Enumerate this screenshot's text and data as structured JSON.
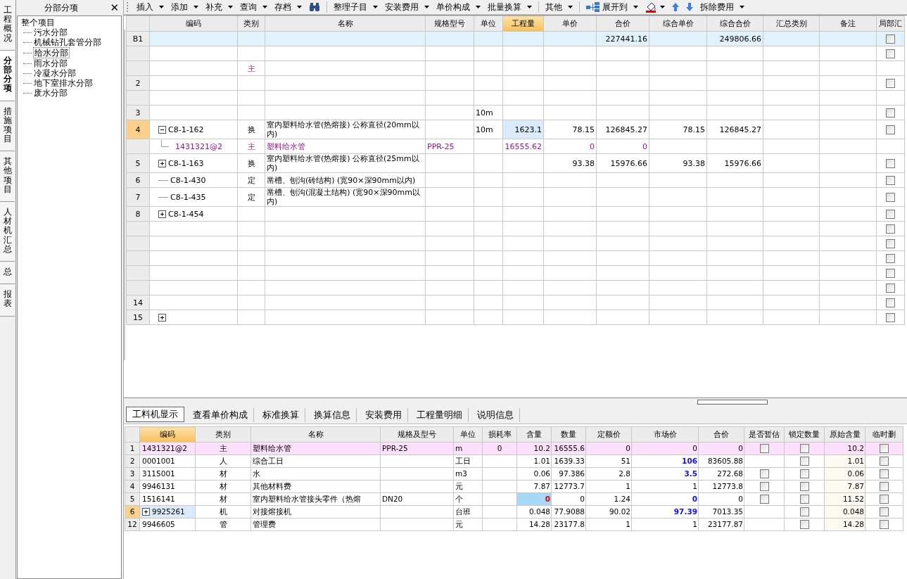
{
  "side_tabs": [
    {
      "label": "工程概况",
      "selected": false
    },
    {
      "label": "分部分项",
      "selected": true
    },
    {
      "label": "措施项目",
      "selected": false
    },
    {
      "label": "其他项目",
      "selected": false
    },
    {
      "label": "人材机汇总",
      "selected": false
    },
    {
      "label": "总",
      "selected": false
    },
    {
      "label": "报表",
      "selected": false
    }
  ],
  "tree_panel": {
    "title": "分部分项",
    "close": "✕",
    "root": {
      "label": "整个项目",
      "selected": false,
      "children": [
        {
          "label": "污水分部",
          "selected": false
        },
        {
          "label": "机械钻孔套管分部",
          "selected": false
        },
        {
          "label": "给水分部",
          "selected": true
        },
        {
          "label": "雨水分部",
          "selected": false
        },
        {
          "label": "冷凝水分部",
          "selected": false
        },
        {
          "label": "地下室排水分部",
          "selected": false
        },
        {
          "label": "废水分部",
          "selected": false
        }
      ]
    }
  },
  "toolbar": [
    {
      "kind": "menu",
      "label": "插入"
    },
    {
      "kind": "menu",
      "label": "添加"
    },
    {
      "kind": "menu",
      "label": "补充"
    },
    {
      "kind": "menu",
      "label": "查询"
    },
    {
      "kind": "menu",
      "label": "存档"
    },
    {
      "kind": "binoculars"
    },
    {
      "kind": "separator"
    },
    {
      "kind": "menu",
      "label": "整理子目"
    },
    {
      "kind": "menu",
      "label": "安装费用"
    },
    {
      "kind": "menu",
      "label": "单价构成"
    },
    {
      "kind": "menu",
      "label": "批量换算"
    },
    {
      "kind": "separator"
    },
    {
      "kind": "menu",
      "label": "其他"
    },
    {
      "kind": "separator"
    },
    {
      "kind": "expand",
      "label": "展开到"
    },
    {
      "kind": "paint"
    },
    {
      "kind": "up"
    },
    {
      "kind": "down"
    },
    {
      "kind": "menu",
      "label": "拆除费用"
    }
  ],
  "upper_table": {
    "columns": [
      {
        "label": "编码",
        "selected": false
      },
      {
        "label": "类别",
        "selected": false
      },
      {
        "label": "名称",
        "selected": false
      },
      {
        "label": "规格型号",
        "selected": false
      },
      {
        "label": "单位",
        "selected": false
      },
      {
        "label": "工程量",
        "selected": true
      },
      {
        "label": "单价",
        "selected": false
      },
      {
        "label": "合价",
        "selected": false
      },
      {
        "label": "综合单价",
        "selected": false
      },
      {
        "label": "综合合价",
        "selected": false
      },
      {
        "label": "汇总类别",
        "selected": false
      },
      {
        "label": "备注",
        "selected": false
      },
      {
        "label": "局部汇",
        "selected": false
      }
    ],
    "rows": [
      {
        "kind": "section",
        "no": "B1",
        "total": "227441.16",
        "grand_total": "249806.66",
        "partial_checked": false,
        "selected": false
      },
      {
        "kind": "item",
        "partial_checked": false,
        "selected": false
      },
      {
        "kind": "material",
        "type": "主",
        "selected": false
      },
      {
        "kind": "item",
        "no": "2",
        "partial_checked": false,
        "selected": false
      },
      {
        "kind": "material",
        "selected": false
      },
      {
        "kind": "item",
        "no": "3",
        "unit": "10m",
        "partial_checked": false,
        "selected": false
      },
      {
        "kind": "item",
        "no": "4",
        "code": "C8-1-162",
        "expanded": true,
        "type": "换",
        "name": "室内塑料给水管(热熔接) 公称直径(20mm以内)",
        "unit": "10m",
        "qty": "1623.1",
        "price": "78.15",
        "total": "126845.27",
        "unit_price": "78.15",
        "grand_total": "126845.27",
        "partial_checked": false,
        "selected": true
      },
      {
        "kind": "material",
        "code": "1431321@2",
        "type": "主",
        "name": "塑料给水管",
        "spec": "PPR-25",
        "qty": "16555.62",
        "price": "0",
        "total": "0",
        "selected": false
      },
      {
        "kind": "item",
        "no": "5",
        "code": "C8-1-163",
        "expanded": false,
        "type": "换",
        "name": "室内塑料给水管(热熔接) 公称直径(25mm以内)",
        "price": "93.38",
        "total": "15976.66",
        "unit_price": "93.38",
        "grand_total": "15976.66",
        "partial_checked": false,
        "selected": false
      },
      {
        "kind": "item",
        "no": "6",
        "code": "C8-1-430",
        "type": "定",
        "name": "凿槽、刨沟(砖结构) (宽90×深90mm以内)",
        "partial_checked": false,
        "selected": false
      },
      {
        "kind": "item",
        "no": "7",
        "code": "C8-1-435",
        "type": "定",
        "name": "凿槽、刨沟(混凝土结构) (宽90×深90mm以内)",
        "partial_checked": false,
        "selected": false
      },
      {
        "kind": "item",
        "no": "8",
        "code": "C8-1-454",
        "expanded": false,
        "partial_checked": false,
        "selected": false
      },
      {
        "kind": "item",
        "partial_checked": false,
        "selected": false
      },
      {
        "kind": "item",
        "partial_checked": false,
        "selected": false
      },
      {
        "kind": "item",
        "partial_checked": false,
        "selected": false
      },
      {
        "kind": "item",
        "partial_checked": false,
        "selected": false
      },
      {
        "kind": "item",
        "partial_checked": false,
        "selected": false
      },
      {
        "kind": "item",
        "no": "14",
        "partial_checked": false,
        "selected": false
      },
      {
        "kind": "item",
        "no": "15",
        "expanded": false,
        "partial_checked": false,
        "selected": false
      }
    ]
  },
  "bottom_tabs": [
    {
      "label": "工料机显示",
      "selected": true
    },
    {
      "label": "查看单价构成",
      "selected": false
    },
    {
      "label": "标准换算",
      "selected": false
    },
    {
      "label": "换算信息",
      "selected": false
    },
    {
      "label": "安装费用",
      "selected": false
    },
    {
      "label": "工程量明细",
      "selected": false
    },
    {
      "label": "说明信息",
      "selected": false
    }
  ],
  "bottom_table": {
    "columns": [
      {
        "label": "编码",
        "selected": true
      },
      {
        "label": "类别",
        "selected": false
      },
      {
        "label": "名称",
        "selected": false
      },
      {
        "label": "规格及型号",
        "selected": false
      },
      {
        "label": "单位",
        "selected": false
      },
      {
        "label": "损耗率",
        "selected": false
      },
      {
        "label": "含量",
        "selected": false
      },
      {
        "label": "数量",
        "selected": false
      },
      {
        "label": "定额价",
        "selected": false
      },
      {
        "label": "市场价",
        "selected": false
      },
      {
        "label": "合价",
        "selected": false
      },
      {
        "label": "是否暂估",
        "selected": false
      },
      {
        "label": "锁定数量",
        "selected": false
      },
      {
        "label": "原始含量",
        "selected": false
      },
      {
        "label": "临时删",
        "selected": false
      }
    ],
    "rows": [
      {
        "kind": "main",
        "no": "1",
        "code": "1431321@2",
        "type": "主",
        "name": "塑料给水管",
        "spec": "PPR-25",
        "unit": "m",
        "loss": "0",
        "content": "10.2",
        "content_error": false,
        "qty": "16555.6",
        "quota_price": "0",
        "market_price": "0",
        "market_changed": false,
        "total": "0",
        "estimate_checked": false,
        "lock_checked": false,
        "original": "10.2",
        "delete_checked": false,
        "selected": false
      },
      {
        "kind": "normal",
        "no": "2",
        "code": "0001001",
        "type": "人",
        "name": "综合工日",
        "unit": "工日",
        "content": "1.01",
        "content_error": false,
        "qty": "1639.33",
        "quota_price": "51",
        "market_price": "106",
        "market_changed": true,
        "total": "83605.88",
        "lock_checked": false,
        "original": "1.01",
        "delete_checked": false,
        "selected": false
      },
      {
        "kind": "normal",
        "no": "3",
        "code": "3115001",
        "type": "材",
        "name": "水",
        "unit": "m3",
        "content": "0.06",
        "content_error": false,
        "qty": "97.386",
        "quota_price": "2.8",
        "market_price": "3.5",
        "market_changed": true,
        "total": "272.68",
        "estimate_checked": false,
        "lock_checked": false,
        "original": "0.06",
        "delete_checked": false,
        "selected": false
      },
      {
        "kind": "normal",
        "no": "4",
        "code": "9946131",
        "type": "材",
        "name": "其他材料费",
        "unit": "元",
        "content": "7.87",
        "content_error": false,
        "qty": "12773.7",
        "quota_price": "1",
        "market_price": "1",
        "market_changed": false,
        "total": "12773.8",
        "estimate_checked": false,
        "lock_checked": false,
        "original": "7.87",
        "delete_checked": false,
        "selected": false
      },
      {
        "kind": "normal",
        "no": "5",
        "code": "1516141",
        "type": "材",
        "name": "室内塑料给水管接头零件（热熔",
        "spec": "DN20",
        "unit": "个",
        "content": "0",
        "content_error": true,
        "qty": "0",
        "quota_price": "1.24",
        "market_price": "0",
        "market_changed": true,
        "total": "0",
        "estimate_checked": false,
        "lock_checked": false,
        "original": "11.52",
        "delete_checked": false,
        "selected": false
      },
      {
        "kind": "normal",
        "no": "6",
        "code": "9925261",
        "expanded": false,
        "type": "机",
        "name": "对接熔接机",
        "unit": "台班",
        "content": "0.048",
        "content_error": false,
        "qty": "77.9088",
        "quota_price": "90.02",
        "market_price": "97.39",
        "market_changed": true,
        "total": "7013.35",
        "lock_checked": false,
        "original": "0.048",
        "delete_checked": false,
        "selected": true
      },
      {
        "kind": "normal",
        "no": "12",
        "code": "9946605",
        "type": "管",
        "name": "管理费",
        "unit": "元",
        "content": "14.28",
        "content_error": false,
        "qty": "23177.8",
        "quota_price": "1",
        "market_price": "1",
        "market_changed": false,
        "total": "23177.87",
        "lock_checked": false,
        "original": "14.28",
        "delete_checked": false,
        "selected": false
      }
    ]
  }
}
